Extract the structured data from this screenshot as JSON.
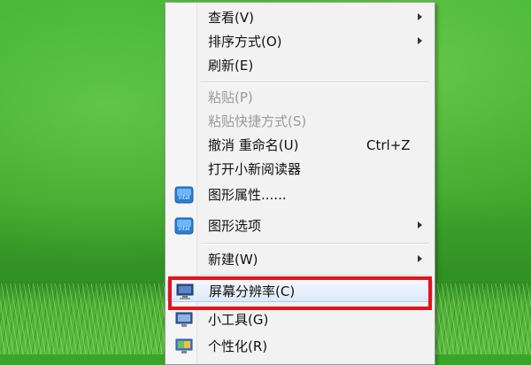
{
  "context_menu": {
    "items": [
      {
        "label": "查看(V)",
        "submenu": true
      },
      {
        "label": "排序方式(O)",
        "submenu": true
      },
      {
        "label": "刷新(E)"
      },
      {
        "label": "粘贴(P)",
        "disabled": true
      },
      {
        "label": "粘贴快捷方式(S)",
        "disabled": true
      },
      {
        "label": "撤消 重命名(U)",
        "shortcut": "Ctrl+Z"
      },
      {
        "label": "打开小新阅读器"
      },
      {
        "label": "图形属性......",
        "icon": "intel-graphics-icon"
      },
      {
        "label": "图形选项",
        "icon": "intel-graphics-icon",
        "submenu": true
      },
      {
        "label": "新建(W)",
        "submenu": true
      },
      {
        "label": "屏幕分辨率(C)",
        "icon": "display-resolution-icon",
        "highlighted": true
      },
      {
        "label": "小工具(G)",
        "icon": "gadgets-icon"
      },
      {
        "label": "个性化(R)",
        "icon": "personalize-icon"
      }
    ]
  },
  "colors": {
    "desktop_green": "#3aa52a",
    "highlight_box": "#e0161a",
    "menu_bg": "#f2f2f2",
    "disabled_text": "#9a9a9a"
  }
}
